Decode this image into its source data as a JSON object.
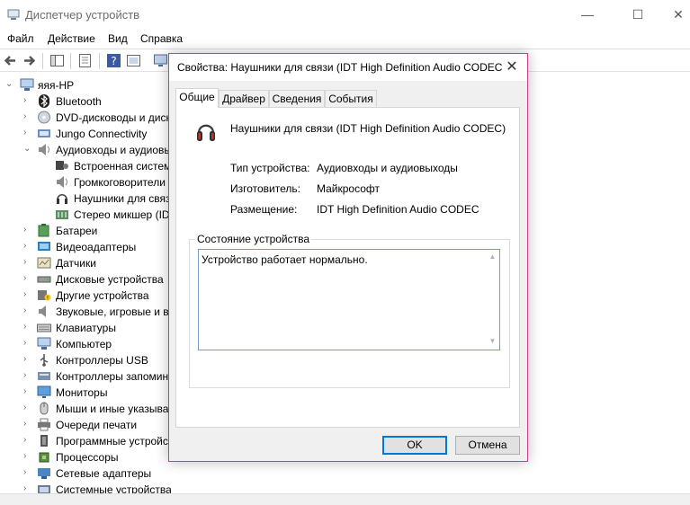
{
  "window": {
    "title": "Диспетчер устройств",
    "controls": {
      "minimize": "—",
      "maximize": "☐",
      "close": "✕"
    }
  },
  "menu": [
    "Файл",
    "Действие",
    "Вид",
    "Справка"
  ],
  "toolbar_icons": [
    "back-icon",
    "forward-icon",
    "tree-view-icon",
    "properties-icon",
    "help-icon",
    "update-driver-icon",
    "monitor-icon"
  ],
  "tree": {
    "root": "яяя-HP",
    "items": [
      {
        "label": "Bluetooth",
        "icon": "bluetooth-icon",
        "expanded": false,
        "level": 1
      },
      {
        "label": "DVD-дисководы и диск",
        "icon": "dvd-icon",
        "expanded": false,
        "level": 1
      },
      {
        "label": "Jungo Connectivity",
        "icon": "jungo-icon",
        "expanded": false,
        "level": 1
      },
      {
        "label": "Аудиовходы и аудиовы",
        "icon": "speaker-icon",
        "expanded": true,
        "level": 1
      },
      {
        "label": "Встроенная систем",
        "icon": "mic-icon",
        "level": 2
      },
      {
        "label": "Громкоговорители",
        "icon": "speaker-icon",
        "level": 2
      },
      {
        "label": "Наушники для связ",
        "icon": "headset-icon",
        "level": 2
      },
      {
        "label": "Стерео микшер (ID",
        "icon": "mixer-icon",
        "level": 2
      },
      {
        "label": "Батареи",
        "icon": "battery-icon",
        "expanded": false,
        "level": 1
      },
      {
        "label": "Видеоадаптеры",
        "icon": "display-adapter-icon",
        "expanded": false,
        "level": 1
      },
      {
        "label": "Датчики",
        "icon": "sensor-icon",
        "expanded": false,
        "level": 1
      },
      {
        "label": "Дисковые устройства",
        "icon": "disk-icon",
        "expanded": false,
        "level": 1
      },
      {
        "label": "Другие устройства",
        "icon": "unknown-device-icon",
        "expanded": false,
        "level": 1
      },
      {
        "label": "Звуковые, игровые и в",
        "icon": "sound-icon",
        "expanded": false,
        "level": 1
      },
      {
        "label": "Клавиатуры",
        "icon": "keyboard-icon",
        "expanded": false,
        "level": 1
      },
      {
        "label": "Компьютер",
        "icon": "computer-icon",
        "expanded": false,
        "level": 1
      },
      {
        "label": "Контроллеры USB",
        "icon": "usb-icon",
        "expanded": false,
        "level": 1
      },
      {
        "label": "Контроллеры запомин",
        "icon": "storage-controller-icon",
        "expanded": false,
        "level": 1
      },
      {
        "label": "Мониторы",
        "icon": "monitor-icon",
        "expanded": false,
        "level": 1
      },
      {
        "label": "Мыши и иные указыва",
        "icon": "mouse-icon",
        "expanded": false,
        "level": 1
      },
      {
        "label": "Очереди печати",
        "icon": "printer-icon",
        "expanded": false,
        "level": 1
      },
      {
        "label": "Программные устройс",
        "icon": "software-device-icon",
        "expanded": false,
        "level": 1
      },
      {
        "label": "Процессоры",
        "icon": "cpu-icon",
        "expanded": false,
        "level": 1
      },
      {
        "label": "Сетевые адаптеры",
        "icon": "network-icon",
        "expanded": false,
        "level": 1
      },
      {
        "label": "Системные устройства",
        "icon": "system-device-icon",
        "expanded": false,
        "level": 1
      }
    ]
  },
  "dialog": {
    "title": "Свойства: Наушники для связи (IDT High Definition Audio CODEC",
    "close": "✕",
    "tabs": [
      {
        "label": "Общие",
        "active": true
      },
      {
        "label": "Драйвер",
        "active": false
      },
      {
        "label": "Сведения",
        "active": false
      },
      {
        "label": "События",
        "active": false
      }
    ],
    "device_name": "Наушники для связи (IDT High Definition Audio CODEC)",
    "properties": [
      {
        "key": "Тип устройства:",
        "value": "Аудиовходы и аудиовыходы"
      },
      {
        "key": "Изготовитель:",
        "value": "Майкрософт"
      },
      {
        "key": "Размещение:",
        "value": "IDT High Definition Audio CODEC"
      }
    ],
    "status_group_label": "Состояние устройства",
    "status_text": "Устройство работает нормально.",
    "ok_button": "OK",
    "cancel_button": "Отмена"
  },
  "colors": {
    "dialog_border": "#c83f8e",
    "focus_blue": "#0078d7"
  }
}
